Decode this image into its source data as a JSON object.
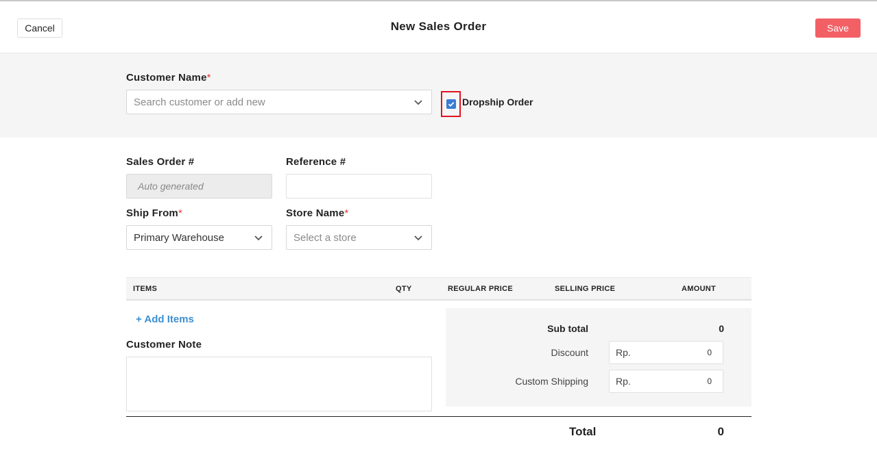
{
  "header": {
    "cancel_label": "Cancel",
    "title": "New Sales Order",
    "save_label": "Save"
  },
  "customer": {
    "label": "Customer Name",
    "required_mark": "*",
    "placeholder": "Search customer or add new",
    "dropship_label": "Dropship Order",
    "dropship_checked": true
  },
  "order": {
    "sales_order_label": "Sales Order #",
    "sales_order_value": "Auto generated",
    "reference_label": "Reference #",
    "reference_value": "",
    "ship_from_label": "Ship From",
    "ship_from_value": "Primary Warehouse",
    "store_label": "Store Name",
    "store_placeholder": "Select a store",
    "required_mark": "*"
  },
  "items_table": {
    "columns": [
      "ITEMS",
      "QTY",
      "REGULAR PRICE",
      "SELLING PRICE",
      "AMOUNT"
    ],
    "add_items_label": "+ Add Items"
  },
  "note": {
    "label": "Customer Note",
    "value": ""
  },
  "summary": {
    "subtotal_label": "Sub total",
    "subtotal_value": "0",
    "discount_label": "Discount",
    "discount_prefix": "Rp.",
    "discount_value": "0",
    "shipping_label": "Custom Shipping",
    "shipping_prefix": "Rp.",
    "shipping_value": "0",
    "total_label": "Total",
    "total_value": "0"
  },
  "colors": {
    "save_button": "#f26065",
    "link": "#3d8fd1",
    "checkbox": "#3a7bd5",
    "highlight_border": "#e0131f",
    "required": "#e03a3a"
  },
  "icons": [
    "chevron-down-icon",
    "checkmark-icon"
  ]
}
